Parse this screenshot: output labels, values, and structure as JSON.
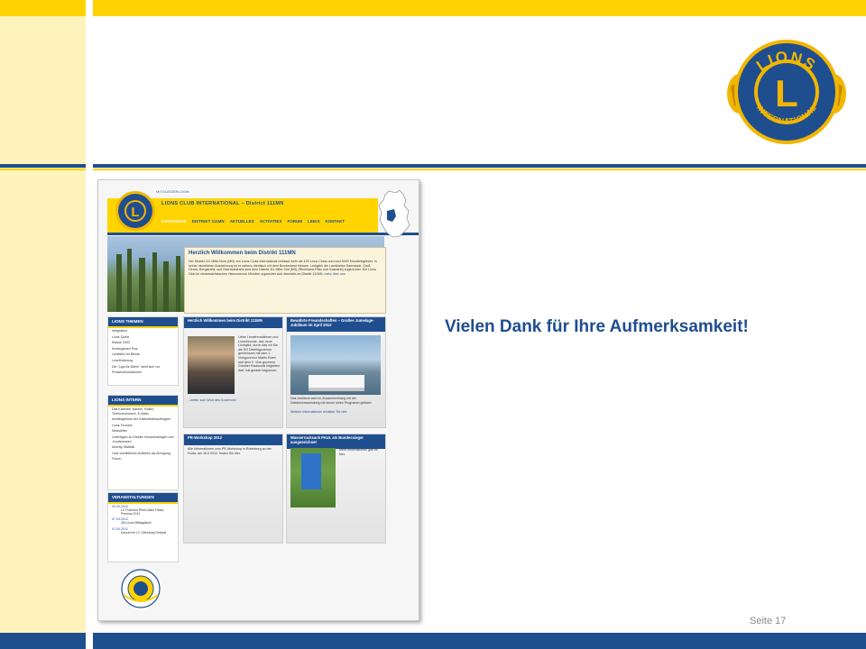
{
  "slide": {
    "thanks_text": "Vielen Dank für Ihre Aufmerksamkeit!",
    "page_label": "Seite 17",
    "colors": {
      "lions_blue": "#1f4e8f",
      "lions_yellow": "#ffd100",
      "pale_yellow": "#fff3bd"
    },
    "logo": {
      "name": "lions-club-international-logo",
      "top_text": "LIONS",
      "bottom_text": "INTERNATIONAL",
      "center": "L"
    }
  },
  "site": {
    "badge": "MITGLIEDERLOGIN",
    "title": "LIONS CLUB INTERNATIONAL – District 111MN",
    "nav": [
      "STARTSEITE",
      "DISTRIKT 111MN",
      "AKTUELLES",
      "ACTIVITIES",
      "FORUM",
      "LINKS",
      "KONTAKT"
    ],
    "welcome": {
      "title": "Herzlich Willkommen beim Distrikt 111MN",
      "body": "Der Distrikt 111 Mitte-Nord (MN) von Lions Clubs International umfasst mehr als 120 Lions Clubs und rund 4000 Einzelmitglieder. In seiner räumlichen Ausdehnung ist er nahezu identisch mit dem Bundesland Hessen. Lediglich die Landkreise Darmstadt, Groß-Gerau, Bergstraße und Odenwaldkreis sind dem Distrikt 111 Mitte Süd (MS) (Rheinland-Pfalz und Saarland) zugeordnet. Der Lions Club im niedersächsischen Hannoversch Münden organisiert sich ebenfalls im Distrikt 111MN.",
      "link": "mehr über uns"
    },
    "side1": {
      "head": "LIONS THEMEN",
      "items": [
        "Integration",
        "Lions Quest",
        "Klasse 2000",
        "Kindergarten Plus",
        "Lichtblick für Blinde",
        "Leseförderung",
        "Die \"Liga für Ältere\" stellt sich vor",
        "Presseinformationen"
      ]
    },
    "side2": {
      "head": "LIONS INTERN",
      "items": [
        "Das Kabinett: Namen, Rollen, Telefonnummern, E-Mails",
        "Arbeitsgebiete der Kabinettsbeauftragten",
        "Lions-Termine",
        "Newsletter",
        "Unterlagen zu Distrikt-Versammlungen und -Konferenzen",
        "Activity-Statistik",
        "Liste vorbildlicher Activities als Anregung",
        "Forum"
      ]
    },
    "side3": {
      "head": "VERANSTALTUNGEN",
      "events": [
        {
          "date": "04.02.2012",
          "text": "LC Frankfurt Rhein Main Fiesta Persona 2012"
        },
        {
          "date": "07.03.2012",
          "text": "264 Lions Mittagstisch"
        },
        {
          "date": "01.04.2012",
          "text": "Konzert im LC Ottenburg Festival"
        },
        {
          "date": "",
          "text": ""
        }
      ]
    },
    "box1": {
      "head": "Herzlich Willkommen beim Distrikt 111MN",
      "text": "Liebe Lionsfreundinnen und Lionsfreunde, das neue Lionsjahr, durch das ich Sie als DG Distriktgovernor gemeinsam mit dem 1. Vizegovernor Martin Ebert und dem 2. Vize-governor Günther Rackowitz begleiten darf, hat gerade begonnen.",
      "link": "...weiter zum Wort des Governors"
    },
    "box2": {
      "head": "Bewährte Freundschaften – Großes Jumelage-Jubiläum im April 2012",
      "text": "Das Jubiläum wird im Zusammenhang mit der Distriktversammlung mit einem tollen Programm gefeiert.",
      "text2": "Weitere Informationen erhalten Sie hier."
    },
    "box3": {
      "head": "PR-Workshop 2012",
      "text": "Alle Informationen zum PR-Workshop in Rotenburg an der Fulda, am 16.2.2012, finden Sie hier."
    },
    "box4": {
      "head": "Wasserrucksack PAUL als Bundessieger ausgezeichnet",
      "text": "Mehr Informationen gibt es hier."
    }
  }
}
